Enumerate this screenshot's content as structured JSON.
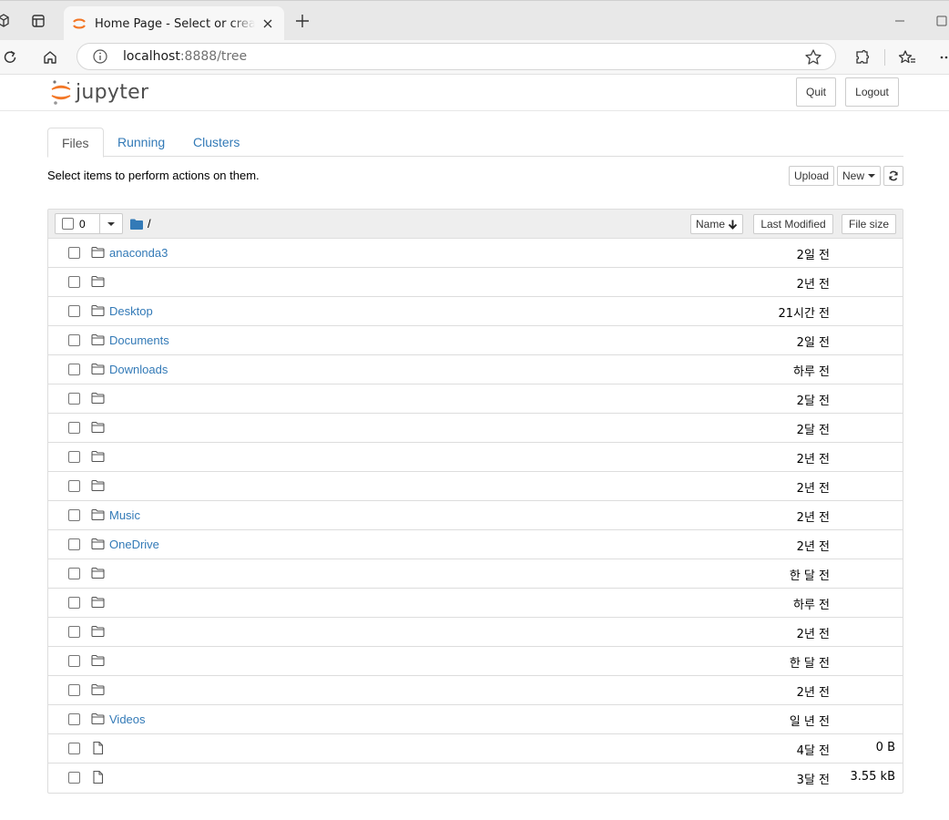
{
  "browser": {
    "tab_title": "Home Page - Select or create a notebook",
    "url_host": "localhost",
    "url_path": ":8888/tree"
  },
  "header": {
    "logo_text": "jupyter",
    "quit_label": "Quit",
    "logout_label": "Logout",
    "accent_color": "#f37726"
  },
  "tabs": [
    {
      "label": "Files",
      "active": true
    },
    {
      "label": "Running",
      "active": false
    },
    {
      "label": "Clusters",
      "active": false
    }
  ],
  "toolbar": {
    "instructions": "Select items to perform actions on them.",
    "upload_label": "Upload",
    "new_label": "New",
    "refresh_icon": "refresh-icon"
  },
  "list_header": {
    "selected_count": "0",
    "breadcrumb": "/",
    "name_label": "Name",
    "modified_label": "Last Modified",
    "size_label": "File size"
  },
  "files": [
    {
      "type": "folder",
      "name": "anaconda3",
      "modified": "2일 전",
      "size": ""
    },
    {
      "type": "folder",
      "name": "",
      "modified": "2년 전",
      "size": ""
    },
    {
      "type": "folder",
      "name": "Desktop",
      "modified": "21시간 전",
      "size": ""
    },
    {
      "type": "folder",
      "name": "Documents",
      "modified": "2일 전",
      "size": ""
    },
    {
      "type": "folder",
      "name": "Downloads",
      "modified": "하루 전",
      "size": ""
    },
    {
      "type": "folder",
      "name": "",
      "modified": "2달 전",
      "size": ""
    },
    {
      "type": "folder",
      "name": "",
      "modified": "2달 전",
      "size": ""
    },
    {
      "type": "folder",
      "name": "",
      "modified": "2년 전",
      "size": ""
    },
    {
      "type": "folder",
      "name": "",
      "modified": "2년 전",
      "size": ""
    },
    {
      "type": "folder",
      "name": "Music",
      "modified": "2년 전",
      "size": ""
    },
    {
      "type": "folder",
      "name": "OneDrive",
      "modified": "2년 전",
      "size": ""
    },
    {
      "type": "folder",
      "name": "",
      "modified": "한 달 전",
      "size": ""
    },
    {
      "type": "folder",
      "name": "",
      "modified": "하루 전",
      "size": ""
    },
    {
      "type": "folder",
      "name": "",
      "modified": "2년 전",
      "size": ""
    },
    {
      "type": "folder",
      "name": "",
      "modified": "한 달 전",
      "size": ""
    },
    {
      "type": "folder",
      "name": "",
      "modified": "2년 전",
      "size": ""
    },
    {
      "type": "folder",
      "name": "Videos",
      "modified": "일 년 전",
      "size": ""
    },
    {
      "type": "file",
      "name": "",
      "modified": "4달 전",
      "size": "0 B"
    },
    {
      "type": "file",
      "name": "",
      "modified": "3달 전",
      "size": "3.55 kB"
    }
  ]
}
